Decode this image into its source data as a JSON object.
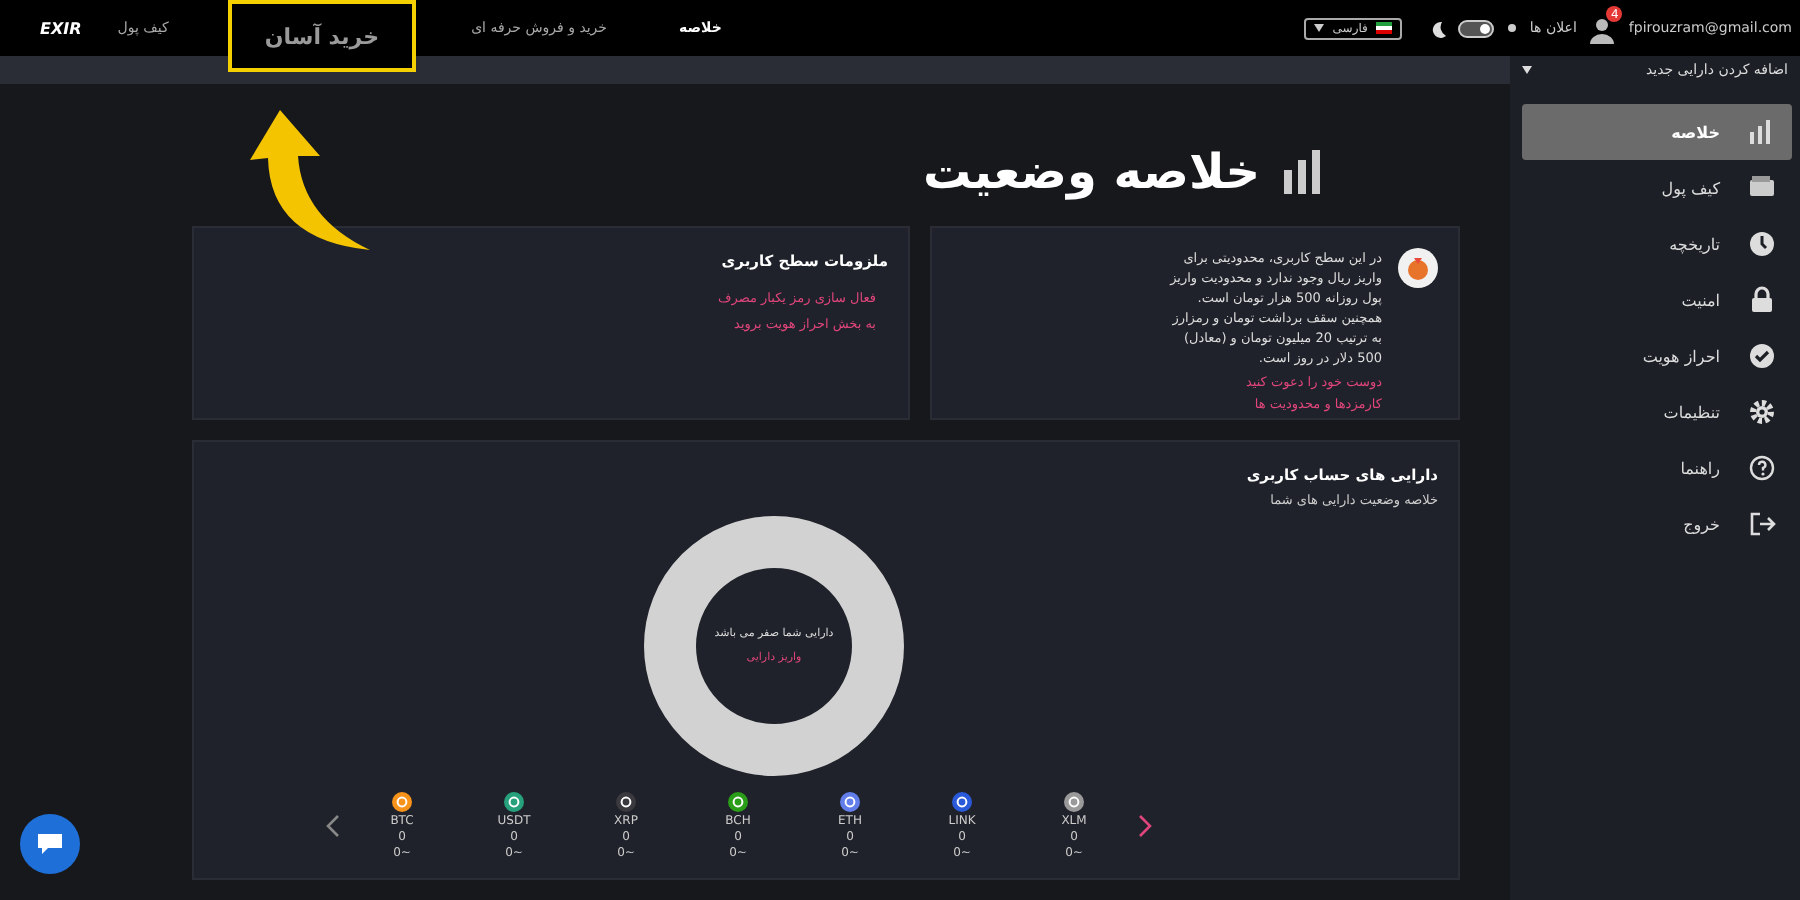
{
  "topbar": {
    "logo": "EXIR",
    "nav": [
      {
        "label": "خلاصه",
        "selected": true,
        "highlighted": false
      },
      {
        "label": "خرید و فروش حرفه ای",
        "selected": false,
        "highlighted": false
      },
      {
        "label": "خرید آسان",
        "selected": false,
        "highlighted": true
      },
      {
        "label": "کیف پول",
        "selected": false,
        "highlighted": false
      }
    ],
    "language": "فارسی",
    "dark_mode": true,
    "notifications_label": "اعلان ها",
    "notification_badge": "4",
    "email": "fpirouzram@gmail.com"
  },
  "add_asset": "اضافه کردن دارایی جدید",
  "sidebar": {
    "items": [
      {
        "label": "خلاصه",
        "selected": true
      },
      {
        "label": "کیف پول",
        "selected": false
      },
      {
        "label": "تاریخچه",
        "selected": false
      },
      {
        "label": "امنیت",
        "selected": false
      },
      {
        "label": "احراز هویت",
        "selected": false
      },
      {
        "label": "تنظیمات",
        "selected": false
      },
      {
        "label": "راهنما",
        "selected": false
      },
      {
        "label": "خروج",
        "selected": false
      }
    ]
  },
  "page_title": "خلاصه وضعیت",
  "level_card": {
    "text": "در این سطح کاربری، محدودیتی برای واریز ریال وجود ندارد و محدودیت واریز پول روزانه 500 هزار تومان است. همچنین سقف برداشت تومان و رمزارز به ترتیب 20 میلیون تومان و (معادل) 500 دلار در روز است.",
    "links": [
      "دوست خود را دعوت کنید",
      "کارمزدها و محدودیت ها"
    ]
  },
  "requirements_card": {
    "title": "ملزومات سطح کاربری",
    "links": [
      "فعال سازی رمز یکبار مصرف",
      "به بخش احراز هویت بروید"
    ]
  },
  "assets": {
    "title": "دارایی های حساب کاربری",
    "subtitle": "خلاصه وضعیت دارایی های شما",
    "donut": {
      "message": "دارایی شما صفر می باشد",
      "action": "واریز دارایی"
    },
    "coins": [
      {
        "symbol": "XLM",
        "balance": "0",
        "value": "~0",
        "color": "#9a9a9a"
      },
      {
        "symbol": "LINK",
        "balance": "0",
        "value": "~0",
        "color": "#2a5ada"
      },
      {
        "symbol": "ETH",
        "balance": "0",
        "value": "~0",
        "color": "#627eea"
      },
      {
        "symbol": "BCH",
        "balance": "0",
        "value": "~0",
        "color": "#2a9d19"
      },
      {
        "symbol": "XRP",
        "balance": "0",
        "value": "~0",
        "color": "#3a3a3e"
      },
      {
        "symbol": "USDT",
        "balance": "0",
        "value": "~0",
        "color": "#26a17b"
      },
      {
        "symbol": "BTC",
        "balance": "0",
        "value": "~0",
        "color": "#f7931a"
      }
    ]
  }
}
